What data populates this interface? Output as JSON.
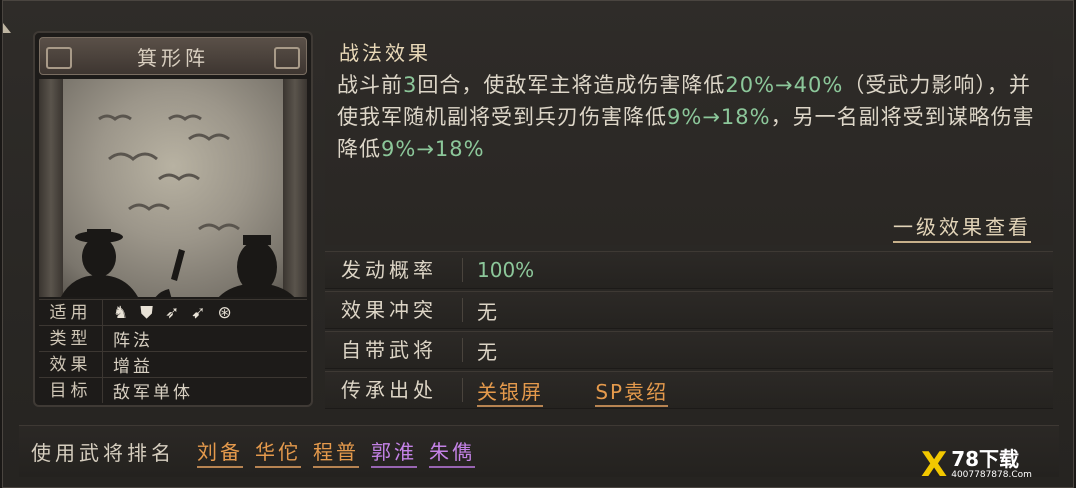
{
  "card": {
    "title": "箕形阵",
    "rows": [
      {
        "label": "适用",
        "icons": [
          "horse-icon",
          "shield-icon",
          "bow-icon",
          "spear-icon",
          "wheel-icon"
        ]
      },
      {
        "label": "类型",
        "value": "阵法"
      },
      {
        "label": "效果",
        "value": "增益"
      },
      {
        "label": "目标",
        "value": "敌军单体"
      }
    ]
  },
  "effect": {
    "title": "战法效果",
    "segments": [
      {
        "t": "战斗前",
        "c": "n"
      },
      {
        "t": "3",
        "c": "g"
      },
      {
        "t": "回合，使敌军主将造成伤害降低",
        "c": "n"
      },
      {
        "t": "20%→40%",
        "c": "g"
      },
      {
        "t": "（受武力影响），并使我军随机副将受到兵刃伤害降低",
        "c": "n"
      },
      {
        "t": "9%→18%",
        "c": "g"
      },
      {
        "t": "，另一名副将受到谋略伤害降低",
        "c": "n"
      },
      {
        "t": "9%→18%",
        "c": "g"
      }
    ],
    "detail_link": "一级效果查看"
  },
  "props": {
    "trigger_rate": {
      "label": "发动概率",
      "value": "100%"
    },
    "conflict": {
      "label": "效果冲突",
      "value": "无"
    },
    "own_general": {
      "label": "自带武将",
      "value": "无"
    },
    "inherit": {
      "label": "传承出处",
      "sources": [
        "关银屏",
        "SP袁绍"
      ]
    }
  },
  "ranking": {
    "label": "使用武将排名",
    "generals": [
      {
        "name": "刘备",
        "quality": "orange"
      },
      {
        "name": "华佗",
        "quality": "orange"
      },
      {
        "name": "程普",
        "quality": "orange"
      },
      {
        "name": "郭淮",
        "quality": "purple"
      },
      {
        "name": "朱儁",
        "quality": "purple"
      }
    ]
  },
  "watermark": {
    "brand": "78下载",
    "url": "4007787878.Com"
  },
  "colors": {
    "green_value": "#8cc79a",
    "orange_quality": "#e59a4c",
    "purple_quality": "#c482e6"
  }
}
